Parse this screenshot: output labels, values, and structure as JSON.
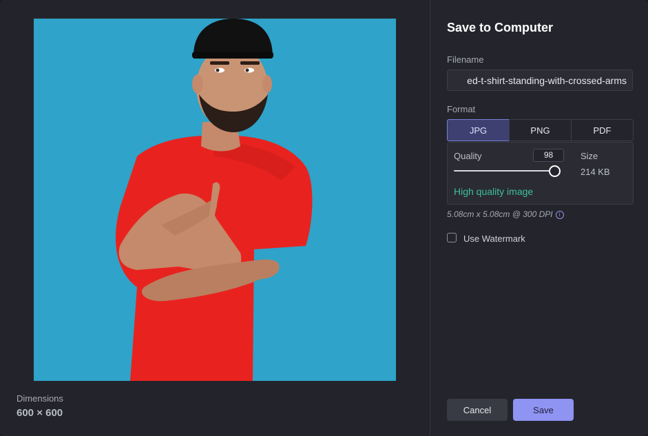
{
  "dialog": {
    "title": "Save to Computer",
    "filename_label": "Filename",
    "filename_value": "ed-t-shirt-standing-with-crossed-arms",
    "format_label": "Format",
    "formats": [
      "JPG",
      "PNG",
      "PDF"
    ],
    "selected_format": "JPG",
    "quality_label": "Quality",
    "quality_value": "98",
    "quality_fraction": 0.98,
    "size_label": "Size",
    "size_value": "214 KB",
    "quality_status": "High quality image",
    "print_size": "5.08cm x 5.08cm @ 300 DPI",
    "info_icon": "info-icon",
    "watermark_label": "Use Watermark",
    "watermark_checked": false,
    "cancel_label": "Cancel",
    "save_label": "Save"
  },
  "preview": {
    "dimensions_label": "Dimensions",
    "dimensions_value": "600 × 600"
  },
  "colors": {
    "accent": "#8f93f2",
    "quality_ok": "#3fbfa0",
    "photo_background": "#2fa3c9",
    "shirt": "#e8231f"
  }
}
